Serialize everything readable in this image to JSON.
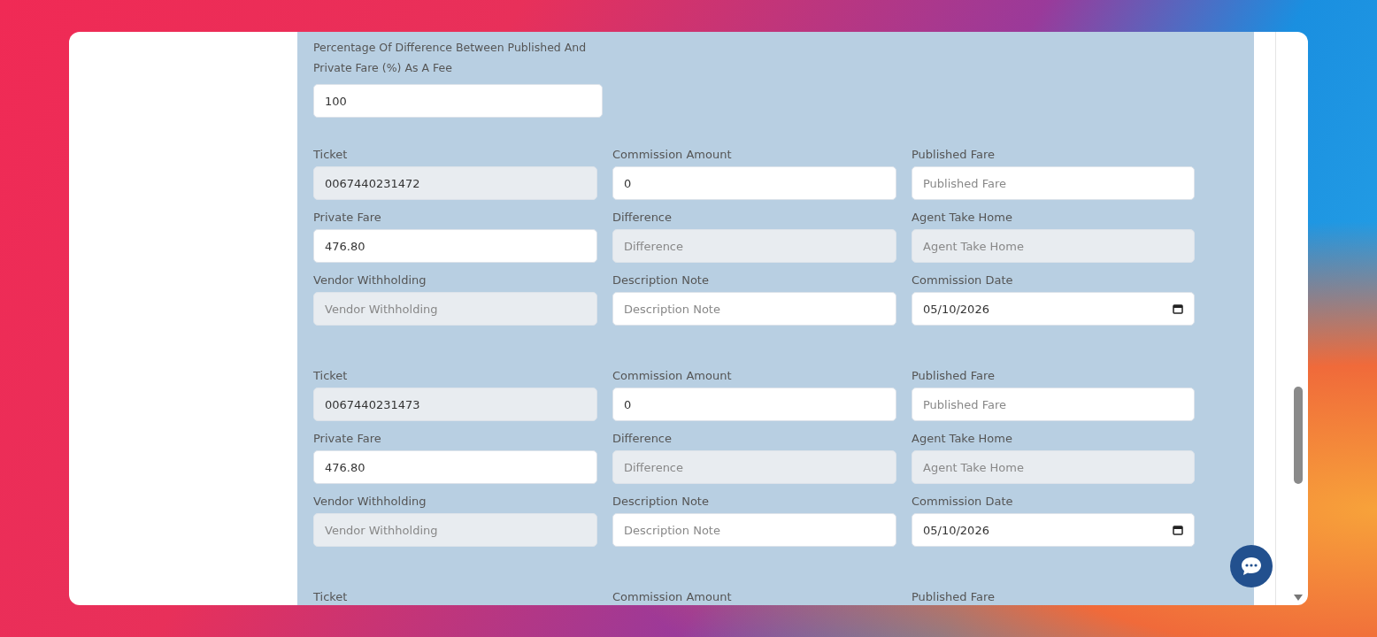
{
  "fee_setting": {
    "label": "Percentage Of Difference Between Published And Private Fare (%) As A Fee",
    "value": "100"
  },
  "tickets": [
    {
      "fields": [
        {
          "label": "Ticket",
          "kind": "text",
          "value": "0067440231472",
          "disabled": true
        },
        {
          "label": "Commission Amount",
          "kind": "text",
          "value": "0",
          "disabled": false
        },
        {
          "label": "Published Fare",
          "kind": "text",
          "placeholder": "Published Fare",
          "disabled": false
        },
        {
          "label": "Private Fare",
          "kind": "text",
          "value": "476.80",
          "disabled": false
        },
        {
          "label": "Difference",
          "kind": "text",
          "placeholder": "Difference",
          "disabled": true
        },
        {
          "label": "Agent Take Home",
          "kind": "text",
          "placeholder": "Agent Take Home",
          "disabled": true
        },
        {
          "label": "Vendor Withholding",
          "kind": "text",
          "placeholder": "Vendor Withholding",
          "disabled": true
        },
        {
          "label": "Description Note",
          "kind": "text",
          "placeholder": "Description Note",
          "disabled": false
        },
        {
          "label": "Commission Date",
          "kind": "date",
          "value": "05/10/2026",
          "disabled": false
        }
      ]
    },
    {
      "fields": [
        {
          "label": "Ticket",
          "kind": "text",
          "value": "0067440231473",
          "disabled": true
        },
        {
          "label": "Commission Amount",
          "kind": "text",
          "value": "0",
          "disabled": false
        },
        {
          "label": "Published Fare",
          "kind": "text",
          "placeholder": "Published Fare",
          "disabled": false
        },
        {
          "label": "Private Fare",
          "kind": "text",
          "value": "476.80",
          "disabled": false
        },
        {
          "label": "Difference",
          "kind": "text",
          "placeholder": "Difference",
          "disabled": true
        },
        {
          "label": "Agent Take Home",
          "kind": "text",
          "placeholder": "Agent Take Home",
          "disabled": true
        },
        {
          "label": "Vendor Withholding",
          "kind": "text",
          "placeholder": "Vendor Withholding",
          "disabled": true
        },
        {
          "label": "Description Note",
          "kind": "text",
          "placeholder": "Description Note",
          "disabled": false
        },
        {
          "label": "Commission Date",
          "kind": "date",
          "value": "05/10/2026",
          "disabled": false
        }
      ]
    }
  ],
  "next_ticket_labels": [
    "Ticket",
    "Commission Amount",
    "Published Fare"
  ]
}
